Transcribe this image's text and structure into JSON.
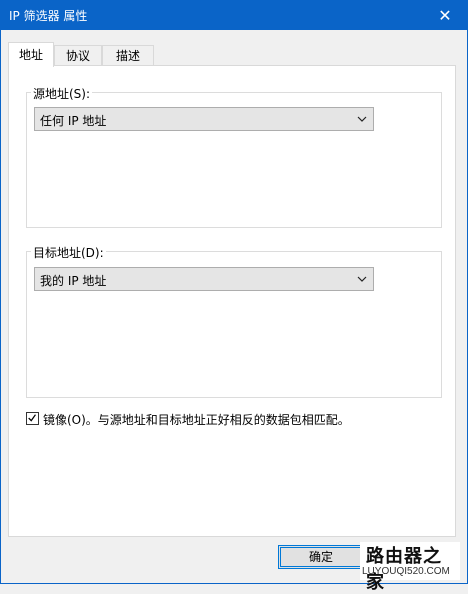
{
  "window": {
    "title": "IP 筛选器 属性",
    "close_glyph": "✕"
  },
  "tabs": [
    {
      "label": "地址",
      "active": true
    },
    {
      "label": "协议",
      "active": false
    },
    {
      "label": "描述",
      "active": false
    }
  ],
  "source": {
    "label": "源地址(S):",
    "selected": "任何 IP 地址"
  },
  "destination": {
    "label": "目标地址(D):",
    "selected": "我的 IP 地址"
  },
  "mirror": {
    "checked": true,
    "label": "镜像(O)。与源地址和目标地址正好相反的数据包相匹配。"
  },
  "buttons": {
    "ok": "确定"
  },
  "watermark": {
    "title": "路由器之家",
    "url": "LUYOUQI520.COM"
  },
  "colors": {
    "titlebar": "#0a64c8",
    "accent": "#0078d7"
  }
}
